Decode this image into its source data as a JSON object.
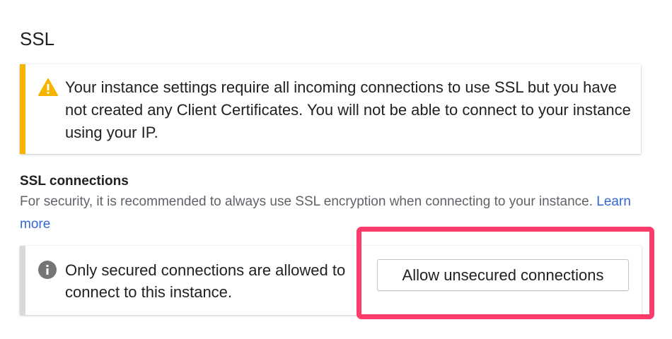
{
  "section": {
    "title": "SSL"
  },
  "warning": {
    "icon": "warning-icon",
    "accent_color": "#f4b400",
    "text": "Your instance settings require all incoming connections to use SSL but you have not created any Client Certificates. You will not be able to connect to your instance using your IP."
  },
  "ssl_connections": {
    "title": "SSL connections",
    "description": "For security, it is recommended to always use SSL encryption when connecting to your instance.",
    "learn_more_label": "Learn more",
    "link_color": "#3367d6"
  },
  "info": {
    "icon": "info-icon",
    "text": "Only secured connections are allowed to connect to this instance.",
    "button_label": "Allow unsecured connections"
  },
  "annotation": {
    "highlight_color": "#ff3b6b"
  }
}
